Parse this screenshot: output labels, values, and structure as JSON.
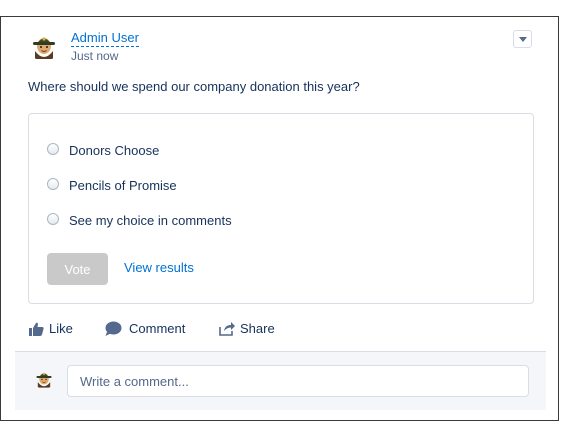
{
  "post": {
    "author": "Admin User",
    "timestamp": "Just now",
    "question": "Where should we spend our company donation this year?",
    "avatar_icon": "ranger-avatar-icon",
    "menu_icon": "chevron-down-icon"
  },
  "poll": {
    "options": [
      {
        "label": "Donors Choose",
        "selected": false
      },
      {
        "label": "Pencils of Promise",
        "selected": false
      },
      {
        "label": "See my choice in comments",
        "selected": false
      }
    ],
    "vote_label": "Vote",
    "vote_enabled": false,
    "view_results_label": "View results"
  },
  "actions": {
    "like_label": "Like",
    "comment_label": "Comment",
    "share_label": "Share"
  },
  "comment_box": {
    "placeholder": "Write a comment...",
    "value": ""
  },
  "colors": {
    "link": "#0070d2",
    "text": "#16325c",
    "muted": "#54698d",
    "border": "#d8dde6",
    "disabled_button": "#c9c9c9",
    "footer_bg": "#f4f6f9"
  }
}
